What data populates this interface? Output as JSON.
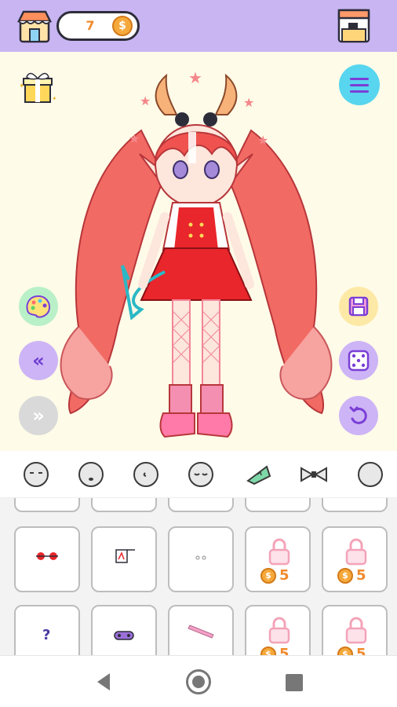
{
  "header": {
    "coins": "7",
    "coin_symbol": "$",
    "icons": [
      "shop-icon",
      "coin-icon",
      "coffee-machine-icon"
    ]
  },
  "stage": {
    "left_buttons": [
      "palette-icon",
      "chevron-double-left-icon",
      "chevron-double-right-icon"
    ],
    "right_buttons": [
      "save-icon",
      "dice-icon",
      "undo-icon"
    ],
    "top_buttons": [
      "gift-icon",
      "menu-icon"
    ],
    "back_label": "«",
    "forward_label": "»"
  },
  "categories": [
    "face-1",
    "face-2",
    "face-3",
    "face-4",
    "tattoo",
    "bow",
    "face-5"
  ],
  "selected_category": 4,
  "grid": {
    "rows": [
      [
        {
          "item": "eyes-red-3d",
          "locked": false
        },
        {
          "item": "sticker-glasses",
          "locked": false
        },
        {
          "item": "dots",
          "locked": false
        },
        {
          "item": "locked-item",
          "locked": true,
          "price_symbol": "$",
          "price": "5"
        },
        {
          "item": "locked-item",
          "locked": true,
          "price_symbol": "$",
          "price": "5"
        }
      ],
      [
        {
          "item": "question-mark",
          "locked": false,
          "label": "?"
        },
        {
          "item": "purple-mask",
          "locked": false
        },
        {
          "item": "pink-bandage",
          "locked": false
        },
        {
          "item": "locked-item",
          "locked": true,
          "price_symbol": "$",
          "price": "5"
        },
        {
          "item": "locked-item",
          "locked": true,
          "price_symbol": "$",
          "price": "5"
        }
      ]
    ]
  },
  "colors": {
    "header": "#c8b5f2",
    "stage": "#fefbe8",
    "accent_purple": "#7a3fd6",
    "coin": "#f6a93b"
  }
}
